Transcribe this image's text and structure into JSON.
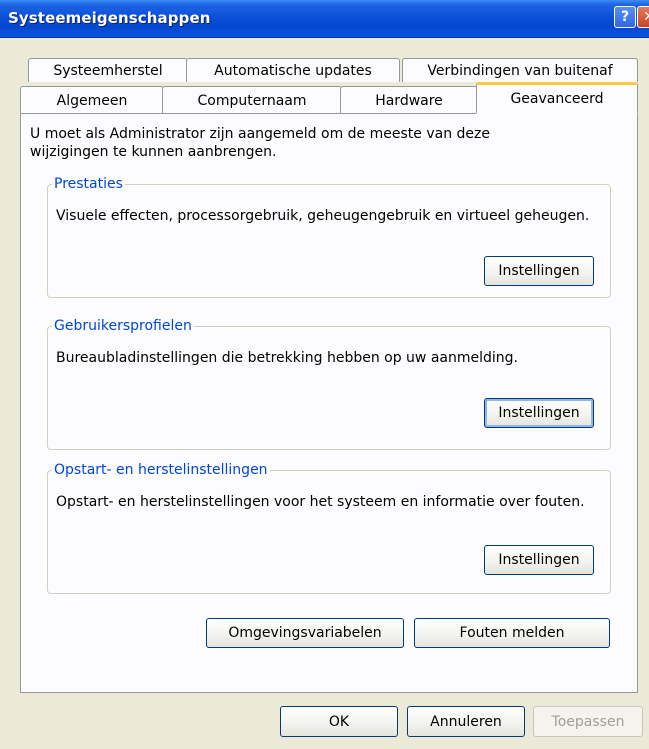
{
  "window": {
    "title": "Systeemeigenschappen",
    "help_label": "?",
    "close_label": "✕"
  },
  "tabs_back": [
    "Systeemherstel",
    "Automatische updates",
    "Verbindingen van buitenaf"
  ],
  "tabs_front": [
    "Algemeen",
    "Computernaam",
    "Hardware",
    "Geavanceerd"
  ],
  "intro": "U moet als Administrator zijn aangemeld om de meeste van deze wijzigingen te kunnen aanbrengen.",
  "groups": {
    "performance": {
      "title": "Prestaties",
      "description": "Visuele effecten, processorgebruik, geheugengebruik en virtueel geheugen.",
      "button": "Instellingen"
    },
    "profiles": {
      "title": "Gebruikersprofielen",
      "description": "Bureaubladinstellingen die betrekking hebben op uw aanmelding.",
      "button": "Instellingen"
    },
    "startup": {
      "title": "Opstart- en herstelinstellingen",
      "description": "Opstart- en herstelinstellingen voor het systeem en informatie over fouten.",
      "button": "Instellingen"
    }
  },
  "buttons": {
    "env_vars": "Omgevingsvariabelen",
    "error_report": "Fouten melden",
    "ok": "OK",
    "cancel": "Annuleren",
    "apply": "Toepassen"
  }
}
